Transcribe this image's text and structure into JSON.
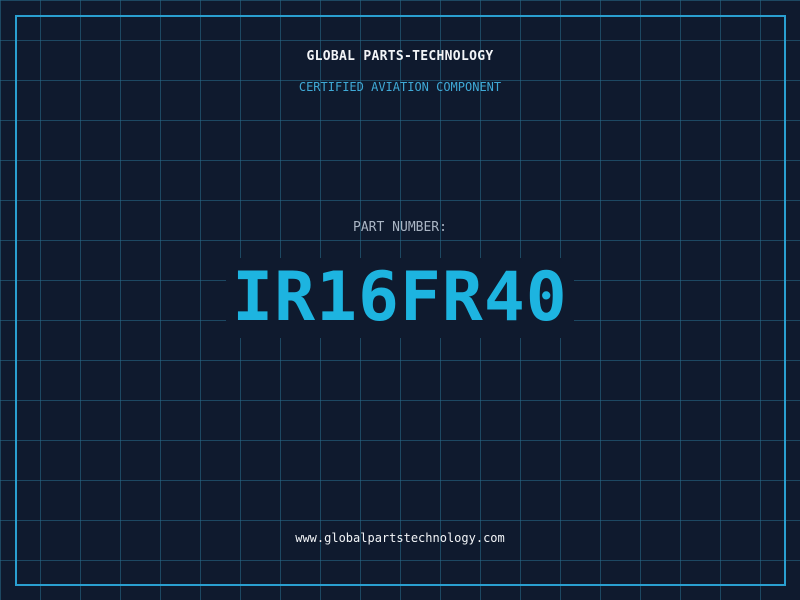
{
  "label": {
    "company_name": "GLOBAL PARTS-TECHNOLOGY",
    "tagline": "CERTIFIED AVIATION COMPONENT",
    "part_label": "PART NUMBER:",
    "part_number": "IR16FR40",
    "website": "www.globalpartstechnology.com"
  },
  "colors": {
    "background": "#0f1a2e",
    "grid": "#286e8c",
    "frame": "#2a9fd0",
    "accent": "#1db4e0",
    "tagline": "#3fa9d6",
    "text": "#f2f4f7",
    "muted_text": "#aab5c4"
  }
}
